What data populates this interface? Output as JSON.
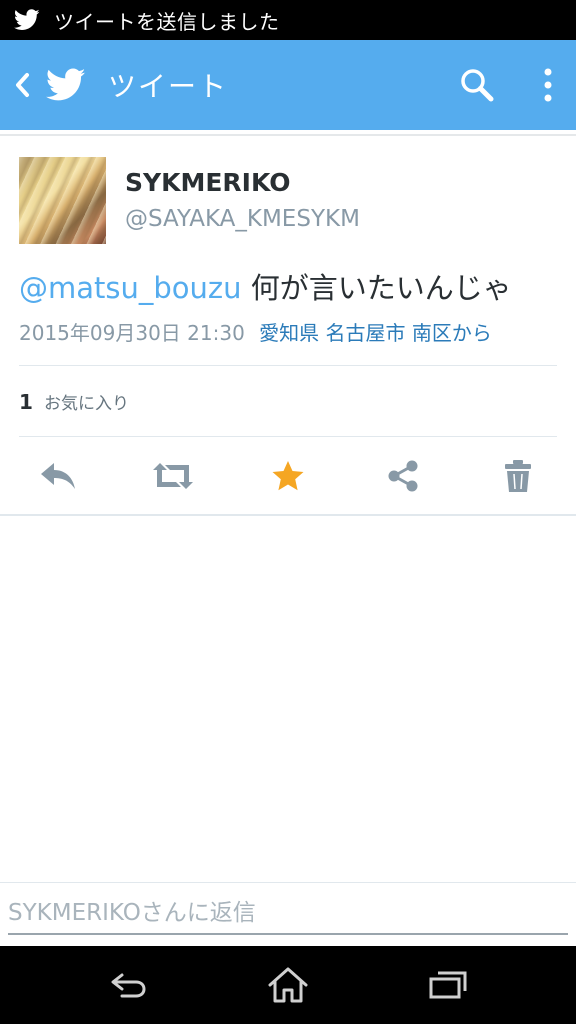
{
  "status_bar": {
    "icon": "twitter-bird-icon",
    "notification_text": "ツイートを送信しました"
  },
  "action_bar": {
    "back_icon": "chevron-left-icon",
    "logo_icon": "twitter-bird-icon",
    "title": "ツイート",
    "search_icon": "search-icon",
    "overflow_icon": "more-vertical-icon",
    "background_color": "#55acee"
  },
  "tweet": {
    "author": {
      "display_name": "SYKMERIKO",
      "handle": "@SAYAKA_KMESYKM"
    },
    "mention": "@matsu_bouzu",
    "body": "何が言いたいんじゃ",
    "timestamp": "2015年09月30日 21:30",
    "location": "愛知県 名古屋市 南区から",
    "favorites": {
      "count": "1",
      "label": "お気に入り"
    },
    "actions": [
      {
        "name": "reply",
        "icon": "reply-icon",
        "color": "#8899a6"
      },
      {
        "name": "retweet",
        "icon": "retweet-icon",
        "color": "#8899a6"
      },
      {
        "name": "favorite",
        "icon": "star-icon",
        "color": "#f5a623",
        "active": true
      },
      {
        "name": "share",
        "icon": "share-icon",
        "color": "#8899a6"
      },
      {
        "name": "delete",
        "icon": "trash-icon",
        "color": "#8899a6"
      }
    ]
  },
  "reply_box": {
    "placeholder": "SYKMERIKOさんに返信"
  },
  "nav_bar": {
    "back_icon": "back-arrow-icon",
    "home_icon": "home-icon",
    "recents_icon": "recent-apps-icon"
  }
}
